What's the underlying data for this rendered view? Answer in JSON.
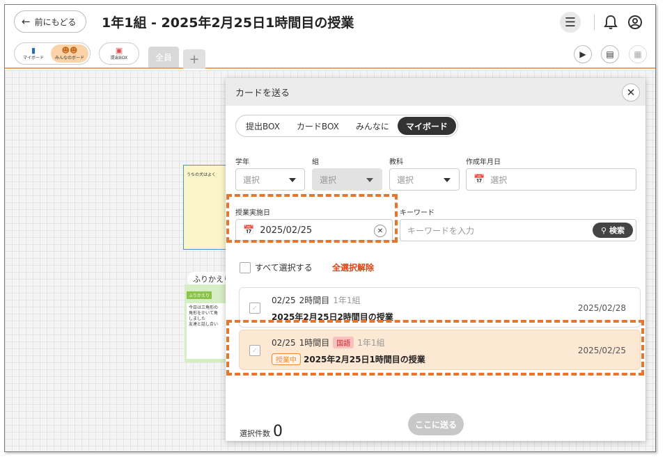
{
  "header": {
    "back_label": "前にもどる",
    "title": "1年1組 - 2025年2月25日1時間目の授業"
  },
  "board_switch": {
    "my_label": "マイボード",
    "minna_label": "みんなのボード",
    "box_label": "提出BOX"
  },
  "tabs": {
    "all": "全員",
    "add": "+"
  },
  "board": {
    "yellow_card_text": "うちの犬はよく",
    "furikaeri_label": "ふりかえり",
    "green_tag": "ふりかえり",
    "green_text_1": "今日は三角形の",
    "green_text_2": "角形をかいて角",
    "green_text_3": "しました",
    "green_text_4": "友達と話し合い"
  },
  "dialog": {
    "title": "カードを送る",
    "tabs": [
      "提出BOX",
      "カードBOX",
      "みんなに",
      "マイボード"
    ],
    "active_tab": "マイボード",
    "grade_label": "学年",
    "class_label": "組",
    "subject_label": "教科",
    "created_label": "作成年月日",
    "select_placeholder": "選択",
    "lesson_date_label": "授業実施日",
    "lesson_date_value": "2025/02/25",
    "keyword_label": "キーワード",
    "keyword_placeholder": "キーワードを入力",
    "search_label": "検索",
    "select_all_label": "すべて選択する",
    "deselect_all_label": "全選択解除",
    "count_label": "選択件数",
    "count_value": "0",
    "send_label": "ここに送る"
  },
  "lessons": [
    {
      "date": "02/25",
      "period": "2時間目",
      "class": "1年1組",
      "title": "2025年2月25日2時間目の授業",
      "right_date": "2025/02/28"
    },
    {
      "date": "02/25",
      "period": "1時間目",
      "subject": "国語",
      "class": "1年1組",
      "status": "授業中",
      "title": "2025年2月25日1時間目の授業",
      "right_date": "2025/02/25"
    }
  ],
  "colors": {
    "accent_orange": "#e8752a",
    "active_row_bg": "#fde8d4",
    "deselect_red": "#d84315"
  }
}
